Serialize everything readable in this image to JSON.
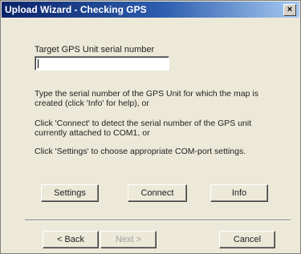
{
  "window": {
    "title": "Upload Wizard - Checking GPS",
    "close_glyph": "×"
  },
  "form": {
    "serial_label": "Target GPS Unit serial number",
    "serial_value": ""
  },
  "instructions": {
    "line1": "Type the serial number of the GPS Unit for which the map is",
    "line2": "created (click 'Info' for help), or",
    "line3": "Click 'Connect' to detect the serial number of the GPS unit",
    "line4": "currently attached to COM1, or",
    "line5": "Click 'Settings' to choose appropriate COM-port settings."
  },
  "buttons": {
    "settings": "Settings",
    "connect": "Connect",
    "info": "Info",
    "back": "< Back",
    "next": "Next >",
    "cancel": "Cancel"
  }
}
